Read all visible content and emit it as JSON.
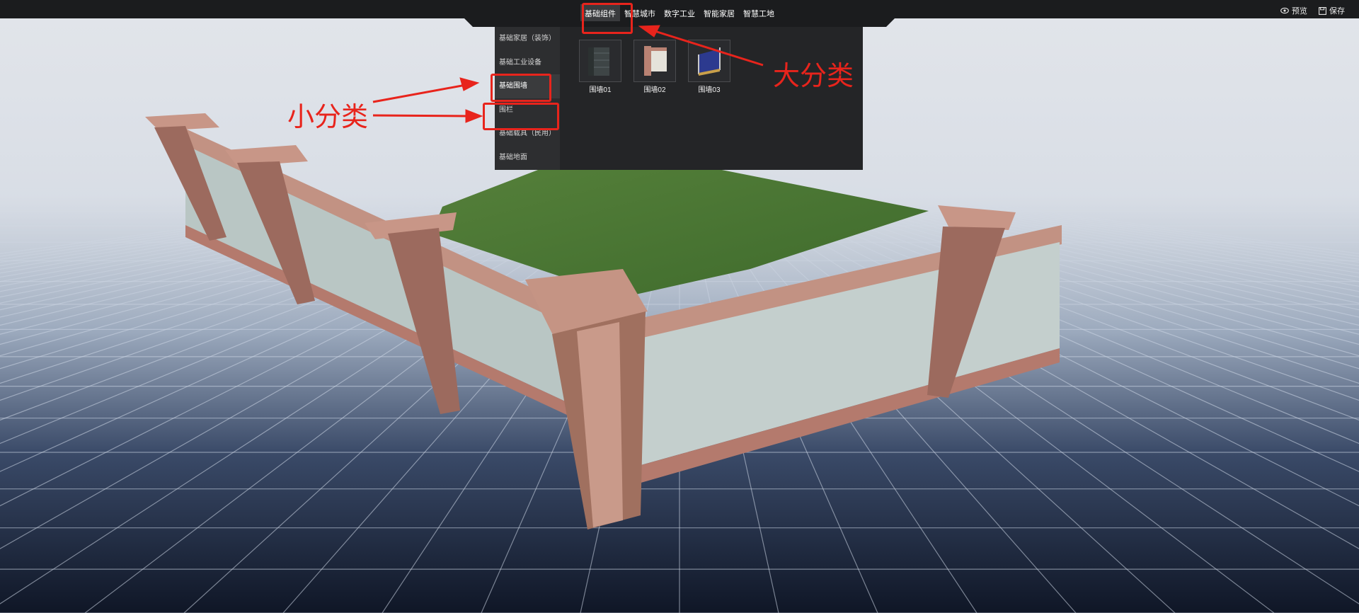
{
  "main_nav": {
    "items": [
      {
        "label": "基础组件",
        "active": true
      },
      {
        "label": "智慧城市",
        "active": false
      },
      {
        "label": "数字工业",
        "active": false
      },
      {
        "label": "智能家居",
        "active": false
      },
      {
        "label": "智慧工地",
        "active": false
      }
    ]
  },
  "toolbar": {
    "preview_label": "预览",
    "save_label": "保存",
    "preview_icon": "eye-icon",
    "save_icon": "save-icon"
  },
  "subcategories": [
    {
      "label": "基础家居（装饰）",
      "active": false
    },
    {
      "label": "基础工业设备",
      "active": false
    },
    {
      "label": "基础围墙",
      "active": true
    },
    {
      "label": "围栏",
      "active": false
    },
    {
      "label": "基础载具（民用）",
      "active": false
    },
    {
      "label": "基础地面",
      "active": false
    }
  ],
  "items": [
    {
      "label": "围墙01"
    },
    {
      "label": "围墙02"
    },
    {
      "label": "围墙03"
    }
  ],
  "annotations": {
    "major_category": "大分类",
    "minor_category": "小分类",
    "color": "#e8241c"
  }
}
